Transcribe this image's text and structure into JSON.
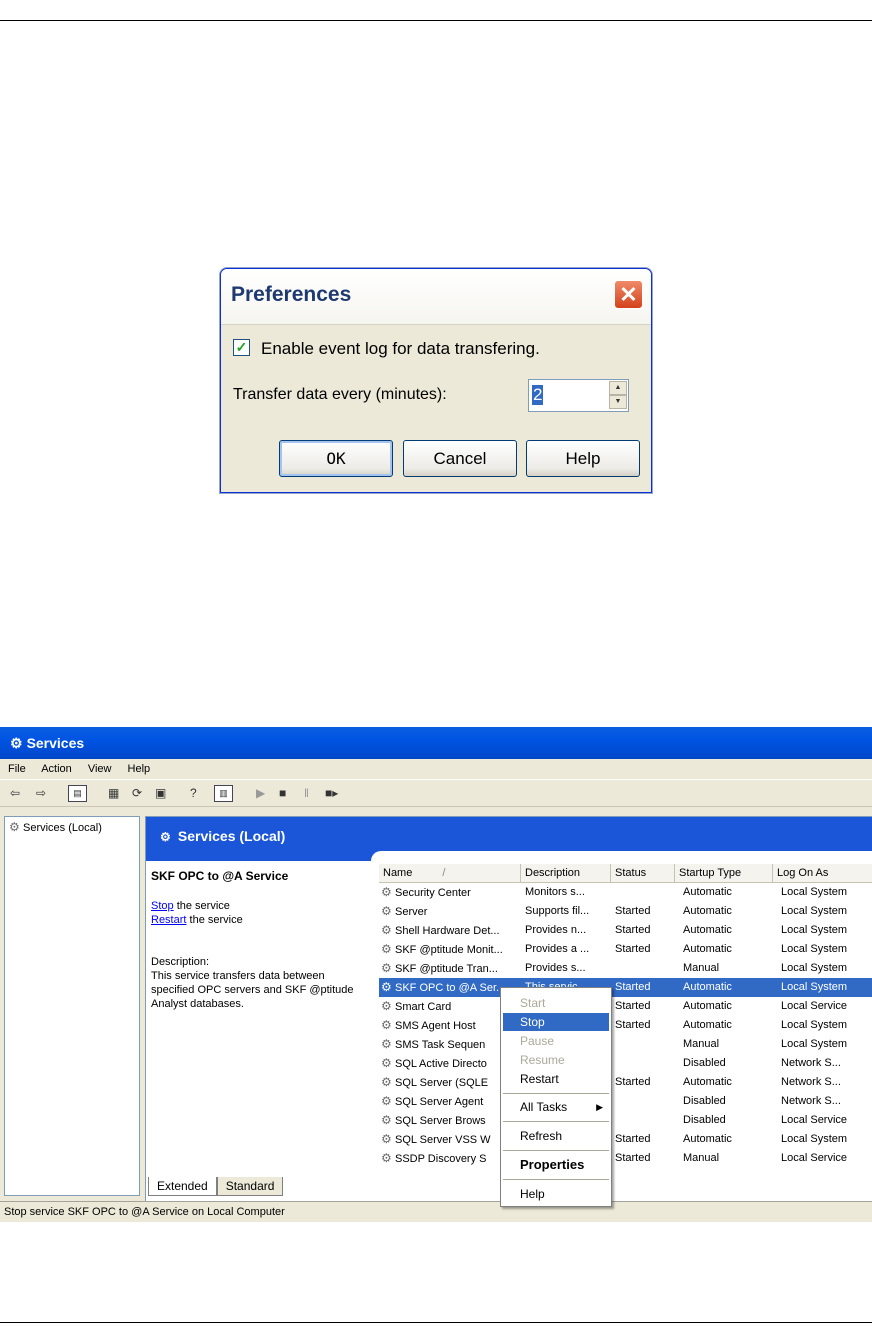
{
  "dialog": {
    "title": "Preferences",
    "close_glyph": "✕",
    "checkbox_label": "Enable event log for data transfering.",
    "checkbox_checked": true,
    "transfer_label": "Transfer data every (minutes):",
    "transfer_value": "2",
    "ok_label": "OK",
    "cancel_label": "Cancel",
    "help_label": "Help"
  },
  "services": {
    "title": "Services",
    "menu": [
      "File",
      "Action",
      "View",
      "Help"
    ],
    "tree_item": "Services (Local)",
    "banner": "Services (Local)",
    "detail": {
      "name": "SKF OPC to @A Service",
      "stop_link": "Stop",
      "stop_rest": " the service",
      "restart_link": "Restart",
      "restart_rest": " the service",
      "desc_label": "Description:",
      "desc_text": "This service transfers data between specified OPC servers and SKF @ptitude Analyst databases."
    },
    "columns": [
      "Name",
      "Description",
      "Status",
      "Startup Type",
      "Log On As"
    ],
    "sort_glyph": "/",
    "rows": [
      [
        "Security Center",
        "Monitors s...",
        "",
        "Automatic",
        "Local System"
      ],
      [
        "Server",
        "Supports fil...",
        "Started",
        "Automatic",
        "Local System"
      ],
      [
        "Shell Hardware Det...",
        "Provides n...",
        "Started",
        "Automatic",
        "Local System"
      ],
      [
        "SKF @ptitude Monit...",
        "Provides a ...",
        "Started",
        "Automatic",
        "Local System"
      ],
      [
        "SKF @ptitude Tran...",
        "Provides s...",
        "",
        "Manual",
        "Local System"
      ],
      [
        "SKF OPC to @A Ser...",
        "This servic...",
        "Started",
        "Automatic",
        "Local System"
      ],
      [
        "Smart Card",
        "",
        "Started",
        "Automatic",
        "Local Service"
      ],
      [
        "SMS Agent Host",
        "",
        "Started",
        "Automatic",
        "Local System"
      ],
      [
        "SMS Task Sequen",
        "",
        "",
        "Manual",
        "Local System"
      ],
      [
        "SQL Active Directo",
        "",
        "",
        "Disabled",
        "Network S..."
      ],
      [
        "SQL Server (SQLE",
        "",
        "Started",
        "Automatic",
        "Network S..."
      ],
      [
        "SQL Server Agent",
        "",
        "",
        "Disabled",
        "Network S..."
      ],
      [
        "SQL Server Brows",
        "",
        "",
        "Disabled",
        "Local Service"
      ],
      [
        "SQL Server VSS W",
        "",
        "Started",
        "Automatic",
        "Local System"
      ],
      [
        "SSDP Discovery S",
        "",
        "Started",
        "Manual",
        "Local Service"
      ]
    ],
    "selected_row": 5,
    "tabs": [
      "Extended",
      "Standard"
    ],
    "status_bar": "Stop service SKF OPC to @A Service on Local Computer",
    "context_menu": {
      "start": "Start",
      "stop": "Stop",
      "pause": "Pause",
      "resume": "Resume",
      "restart": "Restart",
      "all_tasks": "All Tasks",
      "refresh": "Refresh",
      "properties": "Properties",
      "help": "Help"
    }
  }
}
